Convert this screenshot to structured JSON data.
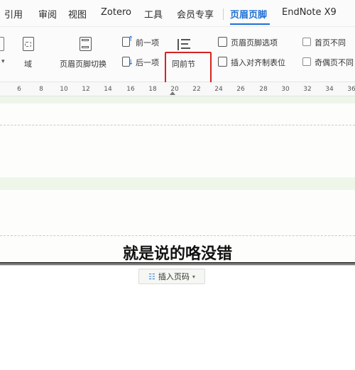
{
  "menu": {
    "tabs": [
      "引用",
      "审阅",
      "视图",
      "Zotero",
      "工具",
      "会员专享",
      "页眉页脚",
      "EndNote X9"
    ],
    "active_tab": "页眉页脚"
  },
  "ribbon": {
    "field_label": "域",
    "switch_header_footer": "页眉页脚切换",
    "previous": "前一项",
    "next": "后一项",
    "same_as_previous": "同前节",
    "header_footer_options": "页眉页脚选项",
    "insert_align_tab": "插入对齐制表位",
    "different_first_page": "首页不同",
    "different_odd_even": "奇偶页不同"
  },
  "ruler": {
    "ticks": [
      "6",
      "8",
      "10",
      "12",
      "14",
      "16",
      "18",
      "20",
      "22",
      "24",
      "26",
      "28",
      "30",
      "32",
      "34",
      "36"
    ]
  },
  "document": {
    "header_text": "就是说的咯没错",
    "insert_page_number": "插入页码"
  },
  "colors": {
    "accent": "#1d6fd6",
    "highlight": "#d7231e",
    "header_area": "#eef6ea"
  }
}
